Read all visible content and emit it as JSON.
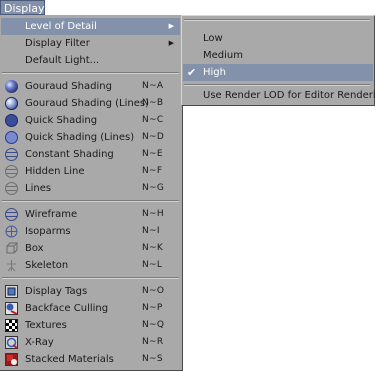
{
  "menubar": {
    "title": "Display"
  },
  "menu": {
    "items": [
      {
        "label": "Level of Detail",
        "shortcut": "",
        "icon": "none",
        "submenu": true,
        "highlighted": true
      },
      {
        "label": "Display Filter",
        "shortcut": "",
        "icon": "none",
        "submenu": true
      },
      {
        "label": "Default Light...",
        "shortcut": "",
        "icon": "none"
      },
      {
        "label": "Gouraud Shading",
        "shortcut": "N~A",
        "icon": "gouraud-shading-icon"
      },
      {
        "label": "Gouraud Shading (Lines)",
        "shortcut": "N~B",
        "icon": "gouraud-shading-lines-icon"
      },
      {
        "label": "Quick Shading",
        "shortcut": "N~C",
        "icon": "quick-shading-icon"
      },
      {
        "label": "Quick Shading (Lines)",
        "shortcut": "N~D",
        "icon": "quick-shading-lines-icon"
      },
      {
        "label": "Constant Shading",
        "shortcut": "N~E",
        "icon": "constant-shading-icon"
      },
      {
        "label": "Hidden Line",
        "shortcut": "N~F",
        "icon": "hidden-line-icon"
      },
      {
        "label": "Lines",
        "shortcut": "N~G",
        "icon": "lines-icon"
      },
      {
        "label": "Wireframe",
        "shortcut": "N~H",
        "icon": "wireframe-icon"
      },
      {
        "label": "Isoparms",
        "shortcut": "N~I",
        "icon": "isoparms-icon"
      },
      {
        "label": "Box",
        "shortcut": "N~K",
        "icon": "box-icon"
      },
      {
        "label": "Skeleton",
        "shortcut": "N~L",
        "icon": "skeleton-icon"
      },
      {
        "label": "Display Tags",
        "shortcut": "N~O",
        "icon": "display-tags-icon"
      },
      {
        "label": "Backface Culling",
        "shortcut": "N~P",
        "icon": "backface-culling-icon"
      },
      {
        "label": "Textures",
        "shortcut": "N~Q",
        "icon": "textures-icon"
      },
      {
        "label": "X-Ray",
        "shortcut": "N~R",
        "icon": "x-ray-icon"
      },
      {
        "label": "Stacked Materials",
        "shortcut": "N~S",
        "icon": "stacked-materials-icon"
      }
    ]
  },
  "submenu": {
    "items": [
      {
        "label": "Low",
        "checked": false
      },
      {
        "label": "Medium",
        "checked": false
      },
      {
        "label": "High",
        "checked": true,
        "highlighted": true
      },
      {
        "label": "Use Render LOD for Editor Rendering",
        "checked": false
      }
    ]
  },
  "colors": {
    "menu_bg": "#a9a9a9",
    "highlight": "#8391aa",
    "menubar_active": "#8290aa"
  }
}
